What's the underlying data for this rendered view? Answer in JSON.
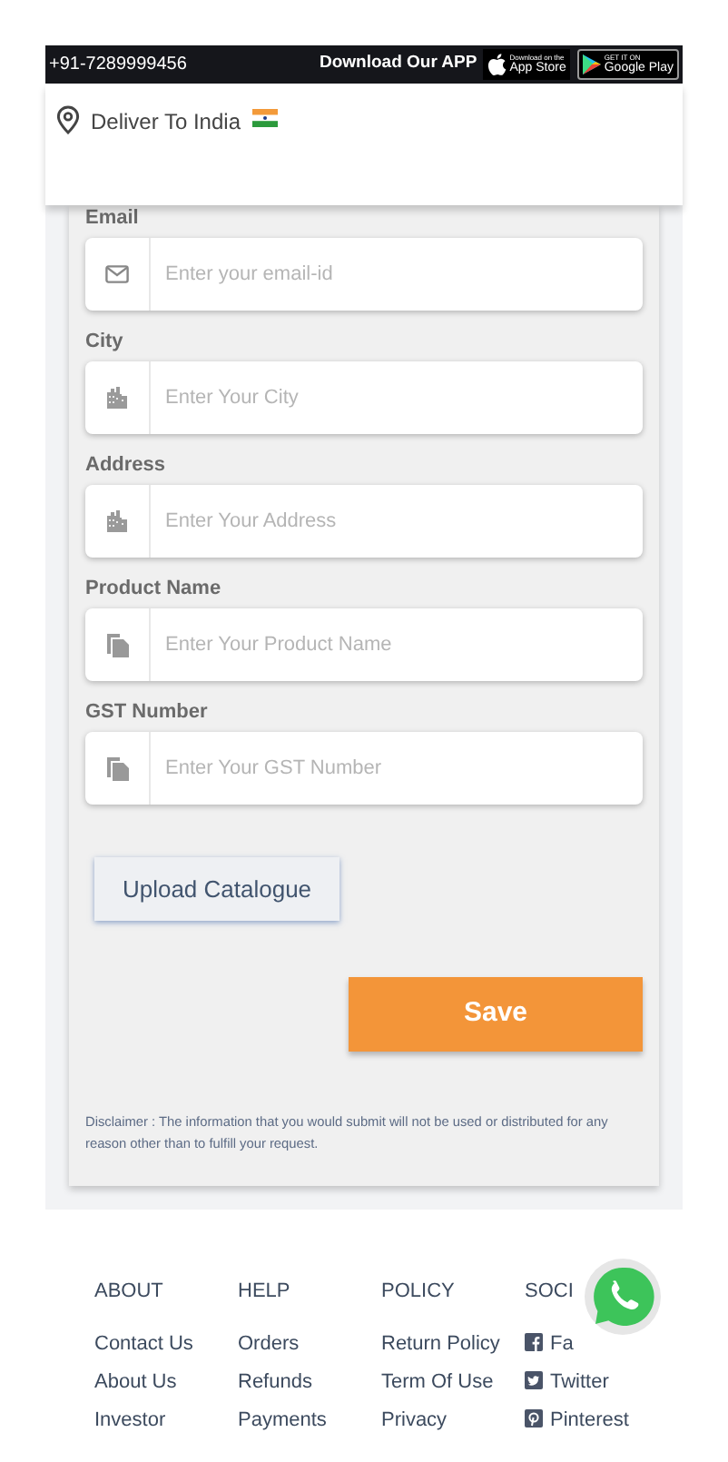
{
  "top_bar": {
    "phone": "+91-7289999456",
    "download_text": "Download Our APP",
    "app_store": {
      "small": "Download on the",
      "large": "App Store"
    },
    "google_play": {
      "small": "GET IT ON",
      "large": "Google Play"
    }
  },
  "deliver": {
    "label": "Deliver To India"
  },
  "form": {
    "fields": [
      {
        "label": "Email",
        "placeholder": "Enter your email-id"
      },
      {
        "label": "City",
        "placeholder": "Enter Your City"
      },
      {
        "label": "Address",
        "placeholder": "Enter Your Address"
      },
      {
        "label": "Product Name",
        "placeholder": "Enter Your Product Name"
      },
      {
        "label": "GST Number",
        "placeholder": "Enter Your GST Number"
      }
    ],
    "upload_button": "Upload Catalogue",
    "save_button": "Save",
    "disclaimer": "Disclaimer : The information that you would submit will not be used or distributed for any reason other than to fulfill your request."
  },
  "footer": {
    "columns": [
      {
        "heading": "ABOUT",
        "links": [
          {
            "label": "Contact Us"
          },
          {
            "label": "About Us"
          },
          {
            "label": "Investor"
          }
        ]
      },
      {
        "heading": "HELP",
        "links": [
          {
            "label": "Orders"
          },
          {
            "label": "Refunds"
          },
          {
            "label": "Payments"
          }
        ]
      },
      {
        "heading": "POLICY",
        "links": [
          {
            "label": "Return Policy"
          },
          {
            "label": "Term Of Use"
          },
          {
            "label": "Privacy"
          }
        ]
      },
      {
        "heading": "SOCI",
        "links": [
          {
            "label": "Fa"
          },
          {
            "label": "Twitter"
          },
          {
            "label": "Pinterest"
          }
        ]
      }
    ]
  }
}
